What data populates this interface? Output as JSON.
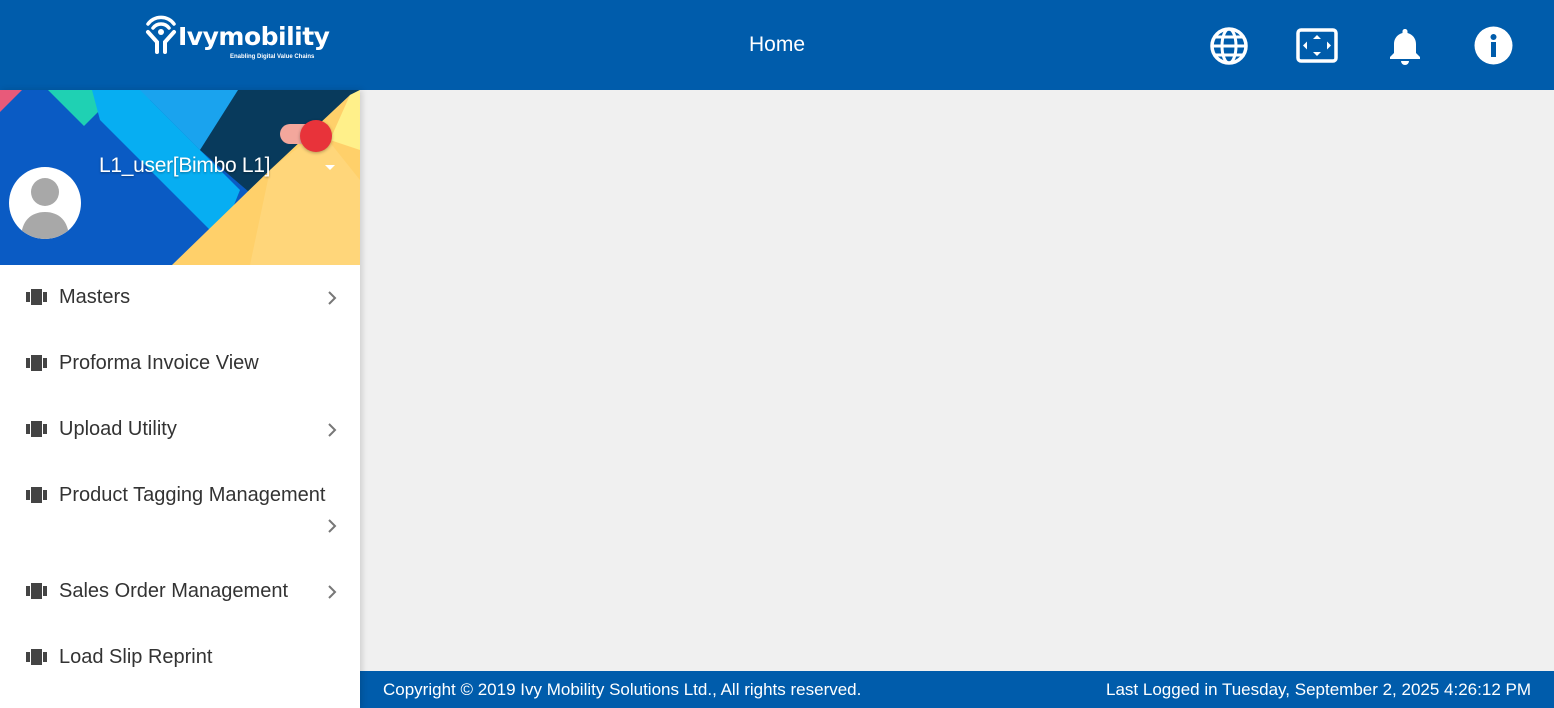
{
  "header": {
    "logo": {
      "text": "Ivymobility",
      "tagline": "Enabling Digital Value Chains"
    },
    "title": "Home",
    "icons": [
      "globe-icon",
      "fullscreen-icon",
      "bell-icon",
      "info-icon"
    ],
    "color": "#005cab"
  },
  "sidebar": {
    "user": {
      "name": "L1_user[Bimbo L1]"
    },
    "items": [
      {
        "label": "Masters",
        "has_submenu": true
      },
      {
        "label": "Proforma Invoice View",
        "has_submenu": false
      },
      {
        "label": "Upload Utility",
        "has_submenu": true
      },
      {
        "label": "Product Tagging Management",
        "has_submenu": true
      },
      {
        "label": "Sales Order Management",
        "has_submenu": true
      },
      {
        "label": "Load Slip Reprint",
        "has_submenu": false
      }
    ]
  },
  "footer": {
    "copyright": "Copyright © 2019 Ivy Mobility Solutions Ltd., All rights reserved.",
    "last_logged": "Last Logged in Tuesday, September 2, 2025 4:26:12 PM"
  },
  "colors": {
    "brand_blue": "#005cab",
    "background": "#f0f0f0",
    "toggle_on": "#e8333a"
  }
}
